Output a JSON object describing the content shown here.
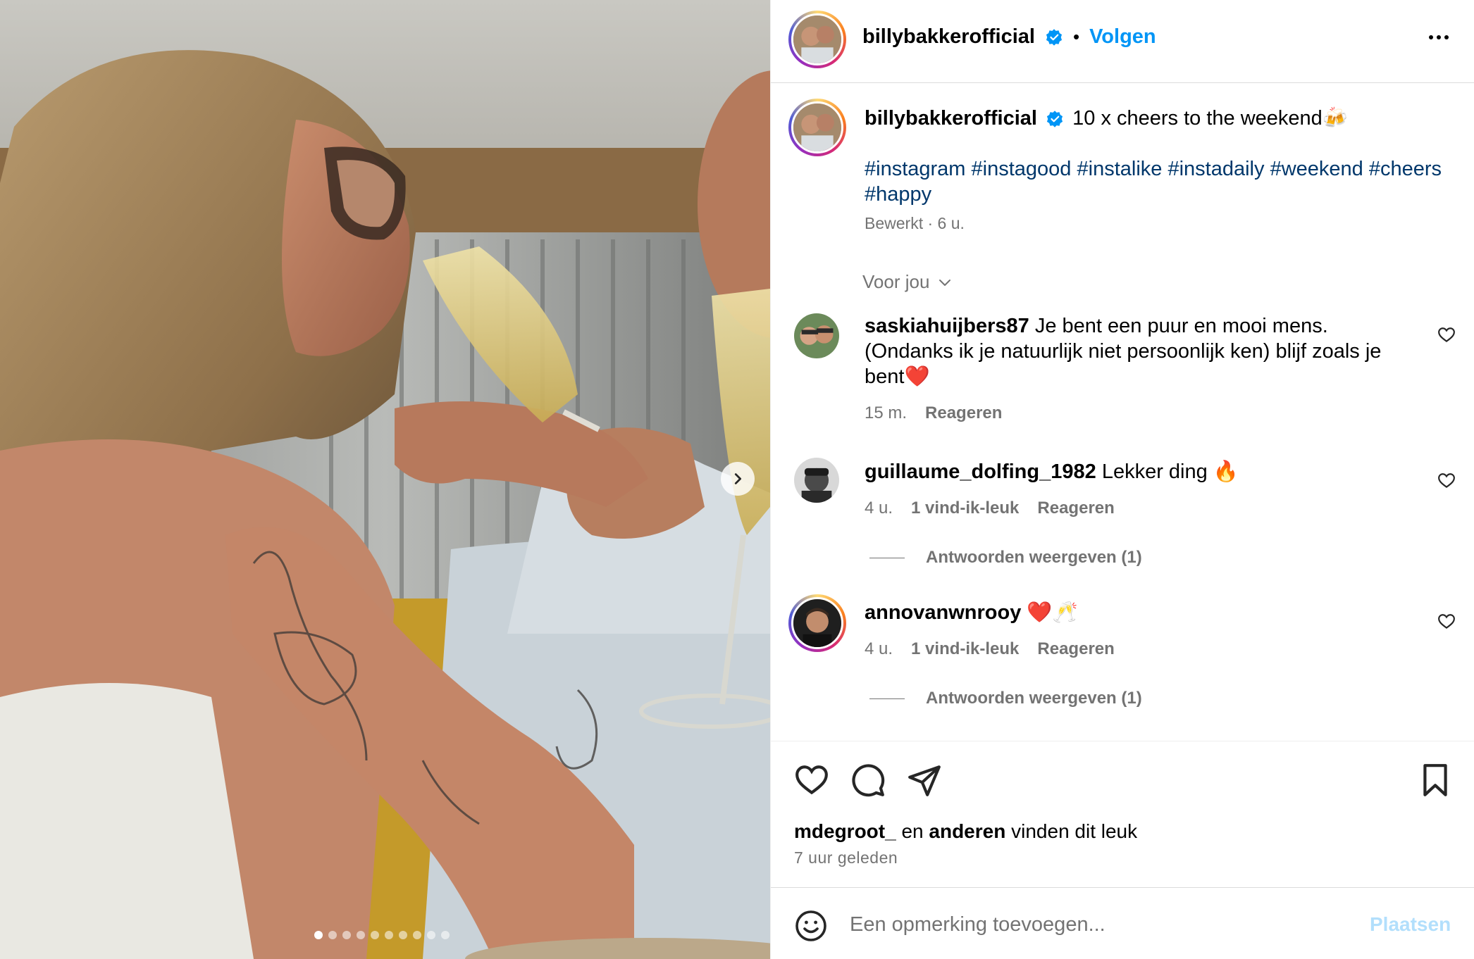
{
  "post": {
    "image_alt": "Two people toasting with champagne glasses",
    "carousel_count": 10,
    "carousel_active": 0
  },
  "header": {
    "username": "billybakkerofficial",
    "separator": "•",
    "follow_label": "Volgen"
  },
  "caption": {
    "username": "billybakkerofficial",
    "text": "10 x cheers to the weekend🍻",
    "hashtags": [
      "#instagram",
      "#instagood",
      "#instalike",
      "#instadaily",
      "#weekend",
      "#cheers",
      "#happy"
    ],
    "edited_label": "Bewerkt",
    "time": "6 u."
  },
  "sort": {
    "label": "Voor jou"
  },
  "comments": [
    {
      "username": "saskiahuijbers87",
      "text": "Je bent een puur en mooi mens. (Ondanks ik je natuurlijk niet persoonlijk ken) blijf zoals je bent❤️",
      "time": "15 m.",
      "likes": "",
      "reply_label": "Reageren",
      "view_replies": ""
    },
    {
      "username": "guillaume_dolfing_1982",
      "text": "Lekker ding 🔥",
      "time": "4 u.",
      "likes": "1 vind-ik-leuk",
      "reply_label": "Reageren",
      "view_replies": "Antwoorden weergeven (1)"
    },
    {
      "username": "annovanwnrooy",
      "text": "❤️🥂",
      "time": "4 u.",
      "likes": "1 vind-ik-leuk",
      "reply_label": "Reageren",
      "view_replies": "Antwoorden weergeven (1)"
    }
  ],
  "likes_line": {
    "user": "mdegroot_",
    "and": "en",
    "others": "anderen",
    "suffix": "vinden dit leuk"
  },
  "posted_ago": "7 uur geleden",
  "comment_box": {
    "placeholder": "Een opmerking toevoegen...",
    "post_label": "Plaatsen"
  },
  "colors": {
    "accent": "#0095f6",
    "hashtag": "#00376b",
    "muted": "#737373",
    "verified": "#0095f6"
  },
  "icons": [
    "emoji-icon",
    "heart-icon",
    "comment-icon",
    "share-icon",
    "bookmark-icon",
    "chevron-right-icon",
    "chevron-down-icon",
    "more-icon",
    "verified-icon"
  ]
}
